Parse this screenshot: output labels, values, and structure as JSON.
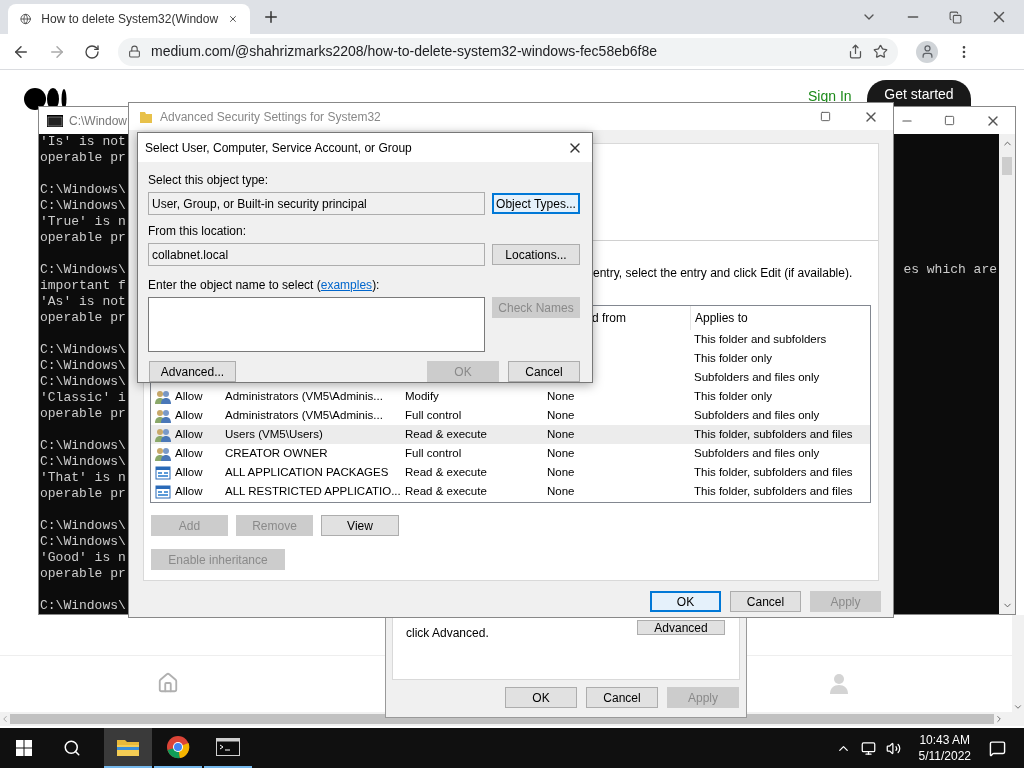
{
  "browser": {
    "tab": {
      "title": "How to delete System32(Window"
    },
    "url": "medium.com/@shahrizmarks2208/how-to-delete-system32-windows-fec58eb6f8e",
    "sign_in": "Sign In",
    "get_started": "Get started"
  },
  "cmd": {
    "title": "C:\\Window",
    "lines": [
      {
        "kind": "text",
        "text": "'Is' is not"
      },
      {
        "kind": "text",
        "text": "operable pr"
      },
      {
        "kind": "blank"
      },
      {
        "kind": "text",
        "text": "C:\\Windows\\"
      },
      {
        "kind": "text",
        "text": "C:\\Windows\\"
      },
      {
        "kind": "text",
        "text": "'True' is n"
      },
      {
        "kind": "text",
        "text": "operable pr"
      },
      {
        "kind": "blank"
      },
      {
        "kind": "text",
        "text": "C:\\Windows\\",
        "right": "es which are"
      },
      {
        "kind": "text",
        "text": "important f"
      },
      {
        "kind": "text",
        "text": "'As' is not"
      },
      {
        "kind": "text",
        "text": "operable pr"
      },
      {
        "kind": "blank"
      },
      {
        "kind": "text",
        "text": "C:\\Windows\\"
      },
      {
        "kind": "text",
        "text": "C:\\Windows\\"
      },
      {
        "kind": "text",
        "text": "C:\\Windows\\"
      },
      {
        "kind": "text",
        "text": "'Classic' i"
      },
      {
        "kind": "text",
        "text": "operable pr"
      },
      {
        "kind": "blank"
      },
      {
        "kind": "text",
        "text": "C:\\Windows\\"
      },
      {
        "kind": "text",
        "text": "C:\\Windows\\"
      },
      {
        "kind": "text",
        "text": "'That' is n"
      },
      {
        "kind": "text",
        "text": "operable pr"
      },
      {
        "kind": "blank"
      },
      {
        "kind": "text",
        "text": "C:\\Windows\\"
      },
      {
        "kind": "text",
        "text": "C:\\Windows\\"
      },
      {
        "kind": "text",
        "text": "'Good' is n"
      },
      {
        "kind": "text",
        "text": "operable pr"
      },
      {
        "kind": "blank"
      },
      {
        "kind": "text",
        "text": "C:\\Windows\\"
      }
    ]
  },
  "properties_dialog": {
    "note": "click Advanced.",
    "advanced_button": "Advanced",
    "buttons": [
      {
        "label": "OK",
        "disabled": false
      },
      {
        "label": "Cancel",
        "disabled": false
      },
      {
        "label": "Apply",
        "disabled": true
      }
    ]
  },
  "advanced_security": {
    "title": "Advanced Security Settings for System32",
    "hint": "entry, select the entry and click Edit (if available).",
    "columns": [
      "d from",
      "Applies to"
    ],
    "rows": [
      {
        "applies_to": "This folder and subfolders",
        "selected": false
      },
      {
        "applies_to": "This folder only",
        "selected": false
      },
      {
        "applies_to": "Subfolders and files only",
        "selected": false
      },
      {
        "kind": "group",
        "type": "Allow",
        "principal": "Administrators (VM5\\Adminis...",
        "access": "Modify",
        "inherited": "None",
        "applies_to": "This folder only",
        "selected": false
      },
      {
        "kind": "group",
        "type": "Allow",
        "principal": "Administrators (VM5\\Adminis...",
        "access": "Full control",
        "inherited": "None",
        "applies_to": "Subfolders and files only",
        "selected": false
      },
      {
        "kind": "group",
        "type": "Allow",
        "principal": "Users (VM5\\Users)",
        "access": "Read & execute",
        "inherited": "None",
        "applies_to": "This folder, subfolders and files",
        "selected": true
      },
      {
        "kind": "group",
        "type": "Allow",
        "principal": "CREATOR OWNER",
        "access": "Full control",
        "inherited": "None",
        "applies_to": "Subfolders and files only",
        "selected": false
      },
      {
        "kind": "package",
        "type": "Allow",
        "principal": "ALL APPLICATION PACKAGES",
        "access": "Read & execute",
        "inherited": "None",
        "applies_to": "This folder, subfolders and files",
        "selected": false
      },
      {
        "kind": "package",
        "type": "Allow",
        "principal": "ALL RESTRICTED APPLICATIO...",
        "access": "Read & execute",
        "inherited": "None",
        "applies_to": "This folder, subfolders and files",
        "selected": false
      }
    ],
    "row_buttons": [
      {
        "label": "Add",
        "disabled": true
      },
      {
        "label": "Remove",
        "disabled": true
      },
      {
        "label": "View",
        "disabled": false
      }
    ],
    "inheritance_button": {
      "label": "Enable inheritance",
      "disabled": true
    },
    "buttons": [
      {
        "label": "OK",
        "disabled": false,
        "focused": true
      },
      {
        "label": "Cancel",
        "disabled": false,
        "focused": false
      },
      {
        "label": "Apply",
        "disabled": true,
        "focused": false
      }
    ]
  },
  "select_dialog": {
    "title": "Select User, Computer, Service Account, or Group",
    "object_type_label": "Select this object type:",
    "object_type": "User, Group, or Built-in security principal",
    "object_types_button": {
      "label": "Object Types...",
      "focused": true
    },
    "location_label": "From this location:",
    "location": "collabnet.local",
    "locations_button": "Locations...",
    "name_label_before": "Enter the object name to select (",
    "examples_link": "examples",
    "name_label_after": "):",
    "check_names_button": {
      "label": "Check Names",
      "disabled": true
    },
    "advanced_button": "Advanced...",
    "buttons": [
      {
        "label": "OK",
        "disabled": true
      },
      {
        "label": "Cancel",
        "disabled": false
      }
    ]
  },
  "taskbar": {
    "apps": [
      {
        "kind": "explorer",
        "selected": true
      },
      {
        "kind": "chrome",
        "selected": false
      },
      {
        "kind": "terminal",
        "selected": false
      }
    ],
    "time": "10:43 AM",
    "date": "5/11/2022"
  }
}
